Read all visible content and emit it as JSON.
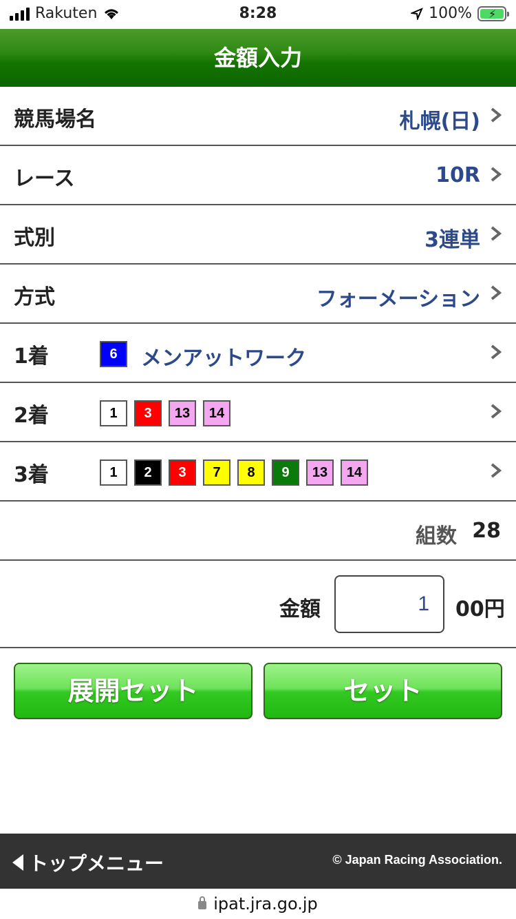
{
  "status_bar": {
    "carrier": "Rakuten",
    "time": "8:28",
    "battery": "100%"
  },
  "header": {
    "title": "金額入力"
  },
  "rows": {
    "venue": {
      "label": "競馬場名",
      "value": "札幌(日)"
    },
    "race": {
      "label": "レース",
      "value": "10R"
    },
    "bet_type": {
      "label": "式別",
      "value": "3連単"
    },
    "method": {
      "label": "方式",
      "value": "フォーメーション"
    },
    "first": {
      "label": "1着",
      "horses": [
        {
          "num": "6",
          "bg": "#0000ff",
          "fg": "#ffffff"
        }
      ],
      "horse_name": "メンアットワーク"
    },
    "second": {
      "label": "2着",
      "horses": [
        {
          "num": "1",
          "bg": "#ffffff",
          "fg": "#000000"
        },
        {
          "num": "3",
          "bg": "#ff0000",
          "fg": "#ffffff"
        },
        {
          "num": "13",
          "bg": "#f4a6f0",
          "fg": "#000000"
        },
        {
          "num": "14",
          "bg": "#f4a6f0",
          "fg": "#000000"
        }
      ]
    },
    "third": {
      "label": "3着",
      "horses": [
        {
          "num": "1",
          "bg": "#ffffff",
          "fg": "#000000"
        },
        {
          "num": "2",
          "bg": "#000000",
          "fg": "#ffffff"
        },
        {
          "num": "3",
          "bg": "#ff0000",
          "fg": "#ffffff"
        },
        {
          "num": "7",
          "bg": "#ffff00",
          "fg": "#000000"
        },
        {
          "num": "8",
          "bg": "#ffff00",
          "fg": "#000000"
        },
        {
          "num": "9",
          "bg": "#0a7a0a",
          "fg": "#ffffff"
        },
        {
          "num": "13",
          "bg": "#f4a6f0",
          "fg": "#000000"
        },
        {
          "num": "14",
          "bg": "#f4a6f0",
          "fg": "#000000"
        }
      ]
    }
  },
  "count": {
    "label": "組数",
    "value": "28"
  },
  "amount": {
    "label": "金額",
    "value": "1",
    "unit": "00円"
  },
  "buttons": {
    "expand_set": "展開セット",
    "set": "セット"
  },
  "footer": {
    "back_label": "トップメニュー",
    "copyright": "© Japan Racing Association."
  },
  "url": "ipat.jra.go.jp",
  "colors": {
    "accent_blue": "#2c4a8a",
    "header_green": "#137300",
    "button_green": "#33c922"
  }
}
